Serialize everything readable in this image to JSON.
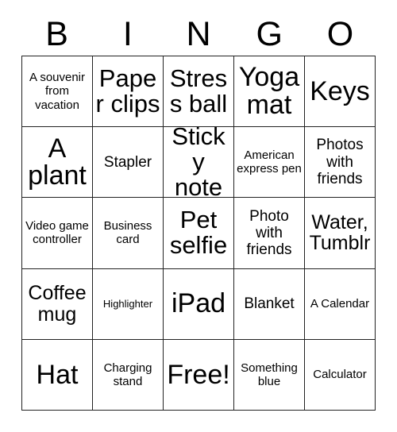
{
  "card": {
    "title": "BINGO",
    "header_letters": [
      "B",
      "I",
      "N",
      "G",
      "O"
    ],
    "free_space_label": "Free!",
    "colors": {
      "background": "#ffffff",
      "text": "#000000",
      "grid_line": "#222222"
    },
    "rows": [
      [
        {
          "text": "A souvenir from vacation",
          "size": "fs-s"
        },
        {
          "text": "Paper clips",
          "size": "fs-xl"
        },
        {
          "text": "Stress ball",
          "size": "fs-xl"
        },
        {
          "text": "Yoga mat",
          "size": "fs-xxl"
        },
        {
          "text": "Keys",
          "size": "fs-xxl"
        }
      ],
      [
        {
          "text": "A plant",
          "size": "fs-xxl"
        },
        {
          "text": "Stapler",
          "size": "fs-m"
        },
        {
          "text": "Sticky note",
          "size": "fs-xl"
        },
        {
          "text": "American express pen",
          "size": "fs-s"
        },
        {
          "text": "Photos with friends",
          "size": "fs-m"
        }
      ],
      [
        {
          "text": "Video game controller",
          "size": "fs-s"
        },
        {
          "text": "Business card",
          "size": "fs-s"
        },
        {
          "text": "Pet selfie",
          "size": "fs-xl"
        },
        {
          "text": "Photo with friends",
          "size": "fs-m"
        },
        {
          "text": "Water, Tumblr",
          "size": "fs-l"
        }
      ],
      [
        {
          "text": "Coffee mug",
          "size": "fs-l"
        },
        {
          "text": "Highlighter",
          "size": "fs-xs"
        },
        {
          "text": "iPad",
          "size": "fs-xxl"
        },
        {
          "text": "Blanket",
          "size": "fs-m"
        },
        {
          "text": "A Calendar",
          "size": "fs-s"
        }
      ],
      [
        {
          "text": "Hat",
          "size": "fs-xxl"
        },
        {
          "text": "Charging stand",
          "size": "fs-s"
        },
        {
          "text": "Free!",
          "size": "fs-xxl"
        },
        {
          "text": "Something blue",
          "size": "fs-s"
        },
        {
          "text": "Calculator",
          "size": "fs-s"
        }
      ]
    ]
  }
}
